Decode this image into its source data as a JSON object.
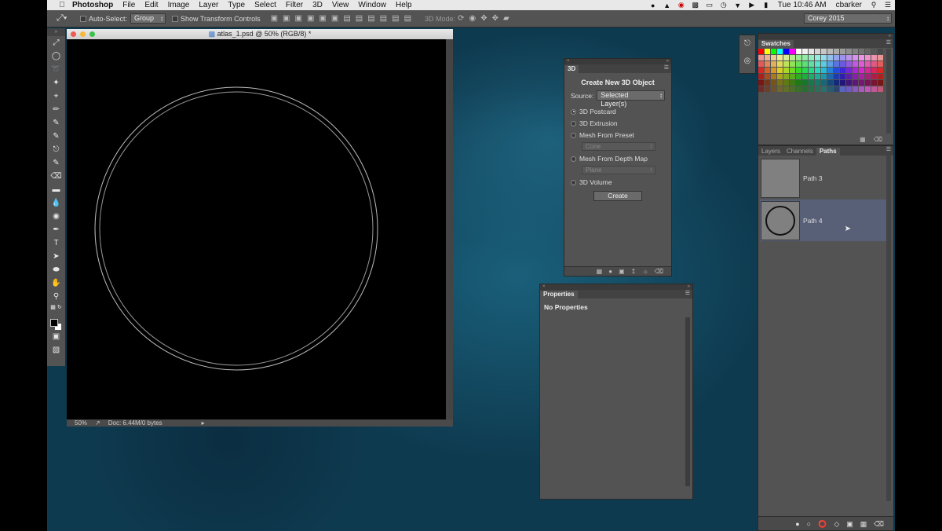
{
  "menubar": {
    "app": "Photoshop",
    "items": [
      "File",
      "Edit",
      "Image",
      "Layer",
      "Type",
      "Select",
      "Filter",
      "3D",
      "View",
      "Window",
      "Help"
    ],
    "clock": "Tue 10:46 AM",
    "user": "cbarker"
  },
  "options": {
    "auto_select_label": "Auto-Select:",
    "auto_select_value": "Group",
    "show_transform_label": "Show Transform Controls",
    "mode3d_label": "3D Mode:",
    "workspace_value": "Corey 2015"
  },
  "document": {
    "title": "atlas_1.psd @ 50% (RGB/8) *",
    "zoom": "50%",
    "doc_info": "Doc: 6.44M/0 bytes"
  },
  "panel3d": {
    "tab": "3D",
    "heading": "Create New 3D Object",
    "source_label": "Source:",
    "source_value": "Selected Layer(s)",
    "options": [
      "3D Postcard",
      "3D Extrusion",
      "Mesh From Preset",
      "Mesh From Depth Map",
      "3D Volume"
    ],
    "preset_value": "Cone",
    "depth_map_value": "Plane",
    "create_label": "Create"
  },
  "properties": {
    "tab": "Properties",
    "body": "No Properties"
  },
  "swatches": {
    "tab": "Swatches"
  },
  "paths_panel": {
    "tabs": [
      "Layers",
      "Channels",
      "Paths"
    ],
    "items": [
      {
        "name": "Path 3"
      },
      {
        "name": "Path 4"
      }
    ]
  },
  "colors": {
    "accent_selected": "#586078",
    "panel_bg": "#535353"
  }
}
